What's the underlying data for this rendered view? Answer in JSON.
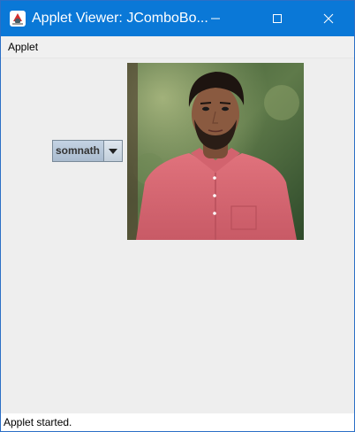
{
  "window": {
    "title": "Applet Viewer: JComboBo...",
    "app_icon": "java-applet-icon",
    "controls": {
      "minimize_icon": "minimize-icon",
      "maximize_icon": "maximize-icon",
      "close_icon": "close-icon"
    },
    "title_bar_color": "#0a78d7"
  },
  "menubar": {
    "items": [
      {
        "label": "Applet"
      }
    ]
  },
  "main": {
    "combo": {
      "selected": "somnath",
      "arrow_icon": "chevron-down-icon"
    },
    "image": {
      "kind": "photo of a young man in a pink shirt outdoors"
    }
  },
  "statusbar": {
    "text": "Applet started."
  }
}
